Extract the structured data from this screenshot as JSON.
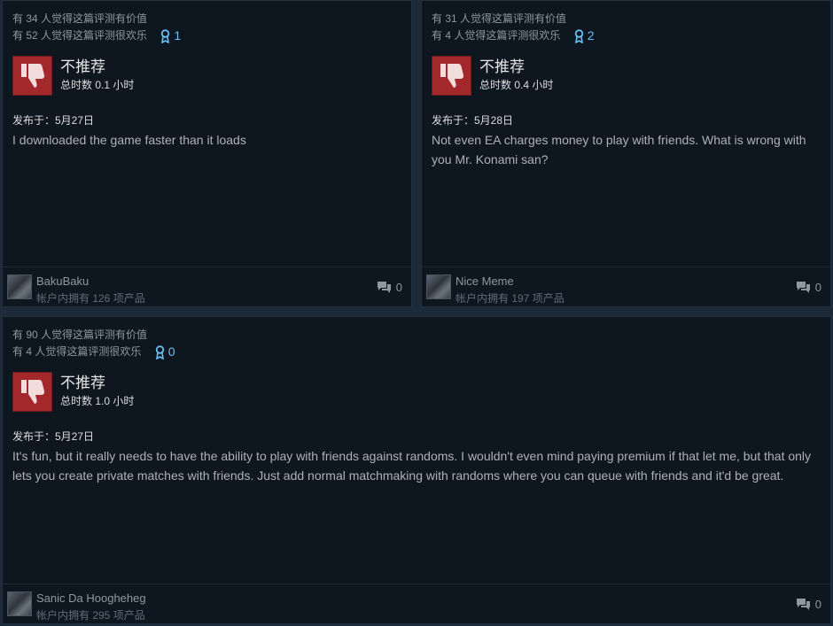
{
  "reviews": [
    {
      "helpful": "有 34 人觉得这篇评测有价值",
      "funny": "有 52 人觉得这篇评测很欢乐",
      "awards": "1",
      "verdict": "不推荐",
      "hours": "总时数 0.1 小时",
      "posted": "发布于：5月27日",
      "text": "I downloaded the game faster than it loads",
      "author": "BakuBaku",
      "products": "帐户内拥有 126 项产品",
      "comments": "0"
    },
    {
      "helpful": "有 31 人觉得这篇评测有价值",
      "funny": "有 4 人觉得这篇评测很欢乐",
      "awards": "2",
      "verdict": "不推荐",
      "hours": "总时数 0.4 小时",
      "posted": "发布于：5月28日",
      "text": "Not even EA charges money to play with friends. What is wrong with you Mr. Konami san?",
      "author": "Nice Meme",
      "products": "帐户内拥有 197 项产品",
      "comments": "0"
    },
    {
      "helpful": "有 90 人觉得这篇评测有价值",
      "funny": "有 4 人觉得这篇评测很欢乐",
      "awards": "0",
      "verdict": "不推荐",
      "hours": "总时数 1.0 小时",
      "posted": "发布于：5月27日",
      "text": "It's fun, but it really needs to have the ability to play with friends against randoms. I wouldn't even mind paying premium if that let me, but that only lets you create private matches with friends. Just add normal matchmaking with randoms where you can queue with friends and it'd be great.",
      "author": "Sanic Da Hoogheheg",
      "products": "帐户内拥有 295 项产品",
      "comments": "0"
    }
  ],
  "icons": {
    "verdict": "thumbs-down-icon",
    "award": "award-ribbon-icon",
    "comments": "comment-bubbles-icon"
  },
  "colors": {
    "thumb_bg": "#a3282b",
    "award": "#66c0f4",
    "card_bg": "#0e1620",
    "page_bg": "#1c2a3a"
  }
}
